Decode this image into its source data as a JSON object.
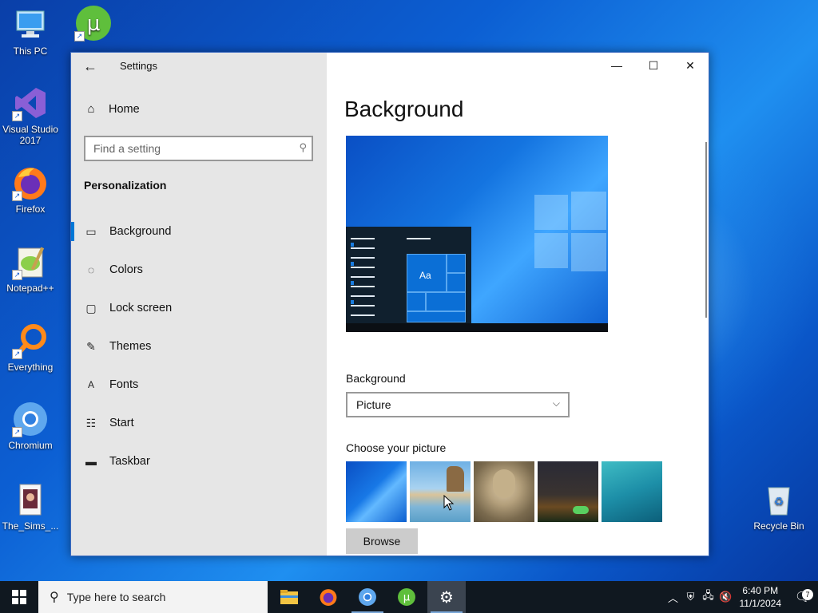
{
  "desktop": {
    "icons": [
      {
        "label": "This PC",
        "icon": "computer-icon"
      },
      {
        "label": "Visual Studio 2017",
        "icon": "visual-studio-icon"
      },
      {
        "label": "Firefox",
        "icon": "firefox-icon"
      },
      {
        "label": "Notepad++",
        "icon": "notepad-plus-plus-icon"
      },
      {
        "label": "Everything",
        "icon": "everything-search-icon"
      },
      {
        "label": "Chromium",
        "icon": "chromium-icon"
      },
      {
        "label": "The_Sims_...",
        "icon": "file-icon"
      },
      {
        "label": "Recycle Bin",
        "icon": "recycle-bin-icon"
      },
      {
        "label": "",
        "icon": "utorrent-icon"
      }
    ]
  },
  "window": {
    "app_title": "Settings",
    "caption": {
      "minimize": "—",
      "maximize": "☐",
      "close": "✕"
    }
  },
  "nav": {
    "home_label": "Home",
    "search_placeholder": "Find a setting",
    "section_title": "Personalization",
    "items": [
      {
        "label": "Background",
        "icon": "picture-icon",
        "active": true
      },
      {
        "label": "Colors",
        "icon": "palette-icon"
      },
      {
        "label": "Lock screen",
        "icon": "lock-screen-icon"
      },
      {
        "label": "Themes",
        "icon": "themes-icon"
      },
      {
        "label": "Fonts",
        "icon": "fonts-icon"
      },
      {
        "label": "Start",
        "icon": "start-icon"
      },
      {
        "label": "Taskbar",
        "icon": "taskbar-icon"
      }
    ]
  },
  "content": {
    "page_title": "Background",
    "preview_tile_text": "Aa",
    "background_label": "Background",
    "background_value": "Picture",
    "choose_label": "Choose your picture",
    "thumbnails": [
      "windows-blue",
      "beach-rocks",
      "portrait",
      "night-sky",
      "underwater"
    ],
    "browse_label": "Browse"
  },
  "taskbar": {
    "search_placeholder": "Type here to search",
    "apps": [
      "file-explorer-icon",
      "firefox-icon",
      "chromium-icon",
      "utorrent-icon",
      "settings-gear-icon"
    ],
    "time": "6:40 PM",
    "date": "11/1/2024",
    "notification_count": "7"
  },
  "colors": {
    "accent": "#0078d7",
    "nav_bg": "#e6e6e6",
    "taskbar_bg": "#101820"
  }
}
